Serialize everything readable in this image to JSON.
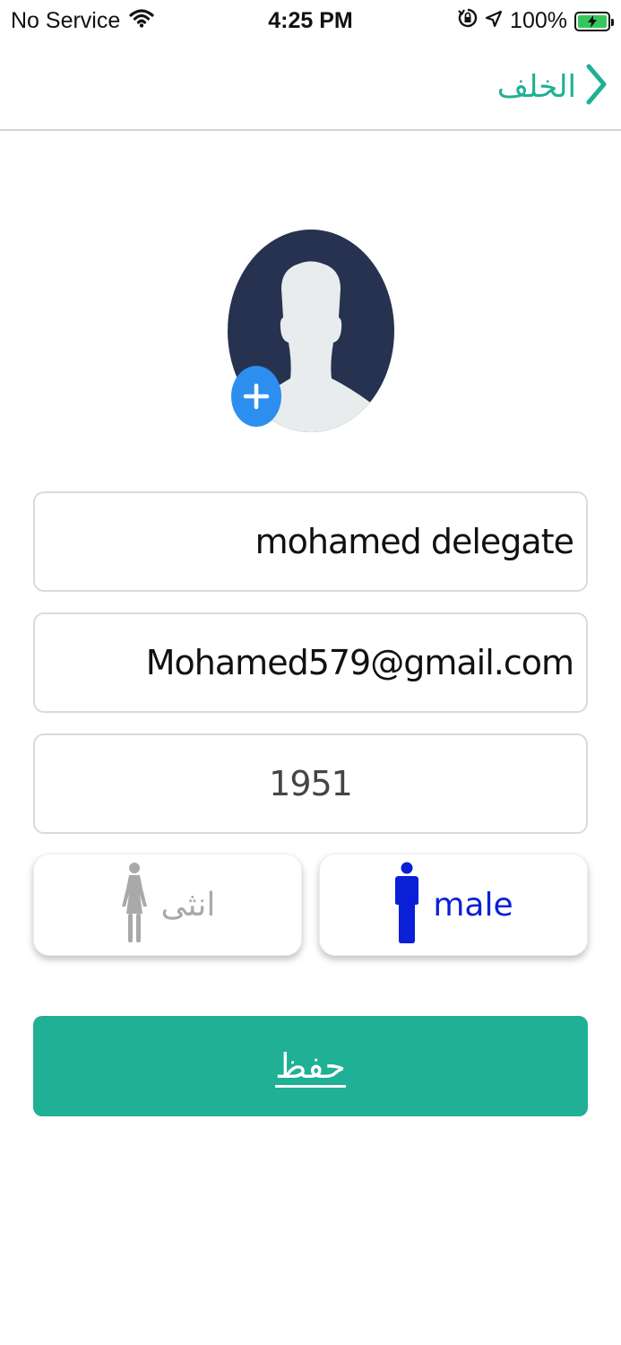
{
  "status_bar": {
    "carrier": "No Service",
    "time": "4:25 PM",
    "battery": "100%"
  },
  "nav": {
    "back_label": "الخلف"
  },
  "form": {
    "name_value": "mohamed delegate",
    "email_value": "Mohamed579@gmail.com",
    "year_value": "1951"
  },
  "gender": {
    "female_label": "انثى",
    "male_label": "male",
    "selected": "male"
  },
  "save_label": "حفظ",
  "colors": {
    "accent": "#1fb095",
    "avatar_bg": "#263250",
    "add_button": "#2c8ff0",
    "male_selected": "#0a20d6",
    "female_inactive": "#a9a9a9"
  }
}
